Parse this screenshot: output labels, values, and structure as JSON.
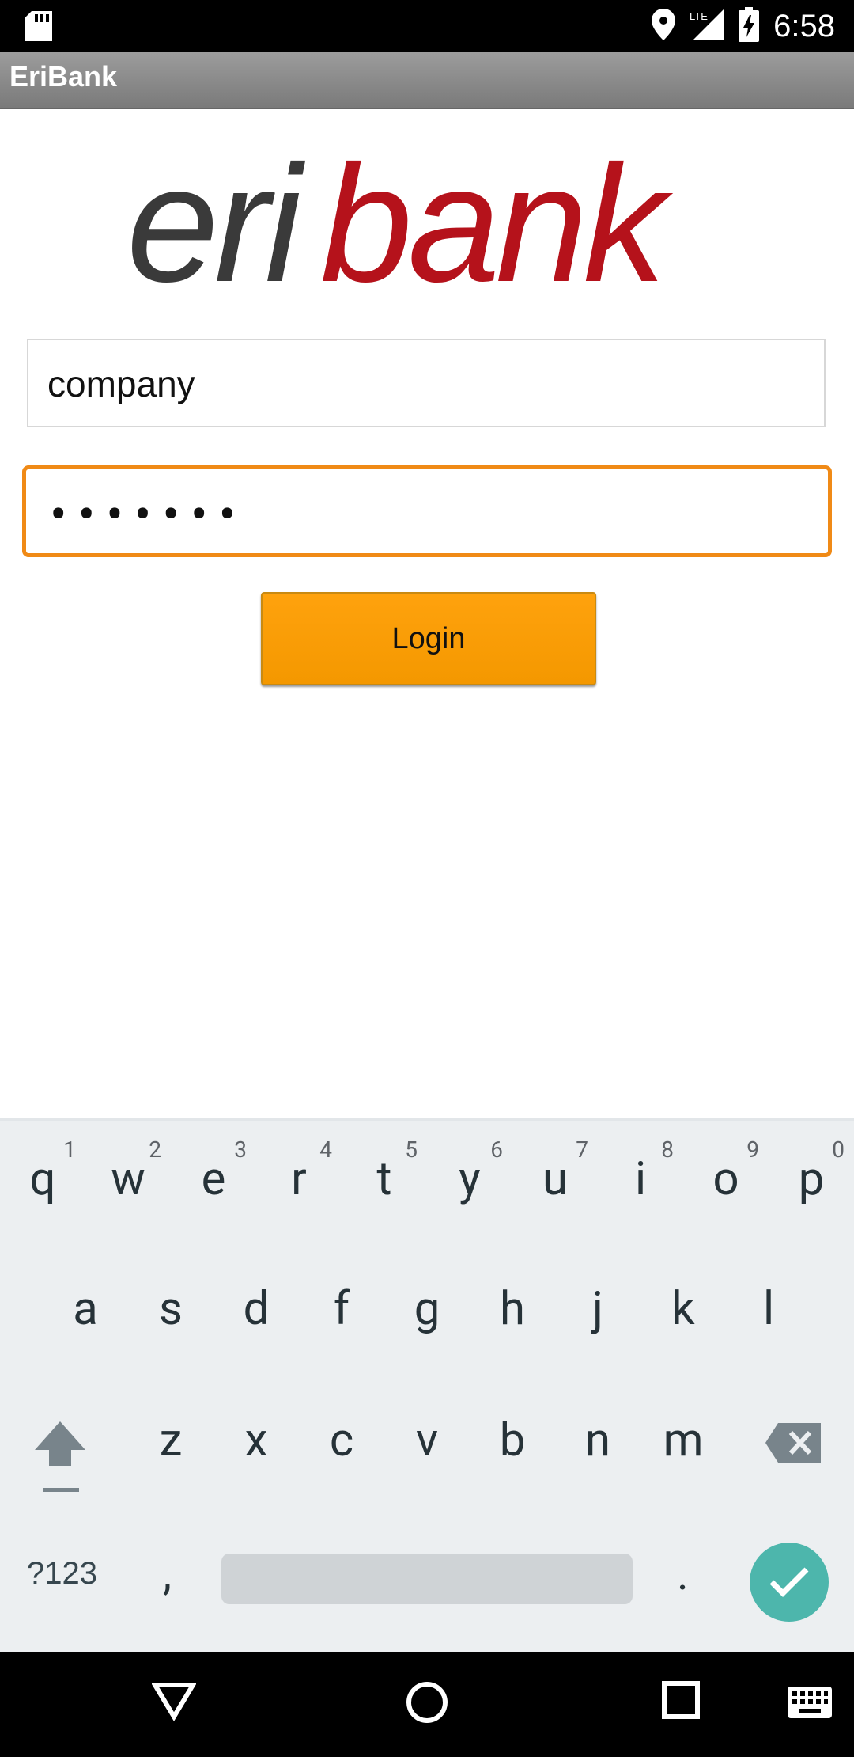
{
  "status_bar": {
    "time": "6:58",
    "network": "LTE"
  },
  "app_bar": {
    "title": "EriBank"
  },
  "login_form": {
    "username_value": "company",
    "password_value": "•••••••",
    "login_button_label": "Login"
  },
  "keyboard": {
    "row1": [
      {
        "char": "q",
        "num": "1"
      },
      {
        "char": "w",
        "num": "2"
      },
      {
        "char": "e",
        "num": "3"
      },
      {
        "char": "r",
        "num": "4"
      },
      {
        "char": "t",
        "num": "5"
      },
      {
        "char": "y",
        "num": "6"
      },
      {
        "char": "u",
        "num": "7"
      },
      {
        "char": "i",
        "num": "8"
      },
      {
        "char": "o",
        "num": "9"
      },
      {
        "char": "p",
        "num": "0"
      }
    ],
    "row2": [
      "a",
      "s",
      "d",
      "f",
      "g",
      "h",
      "j",
      "k",
      "l"
    ],
    "row3": [
      "z",
      "x",
      "c",
      "v",
      "b",
      "n",
      "m"
    ],
    "symbols_label": "?123",
    "comma": ",",
    "period": "."
  },
  "icons": {
    "status_left": "sd-card-icon",
    "status_right": [
      "location-icon",
      "lte-signal-icon",
      "battery-charging-icon"
    ],
    "nav": [
      "back-icon",
      "home-icon",
      "recents-icon",
      "keyboard-icon"
    ]
  },
  "colors": {
    "accent_orange": "#f49800",
    "focus_border": "#f08a16",
    "logo_dark": "#3a3a3a",
    "logo_red": "#b5121b",
    "enter_teal": "#4db6ac"
  }
}
